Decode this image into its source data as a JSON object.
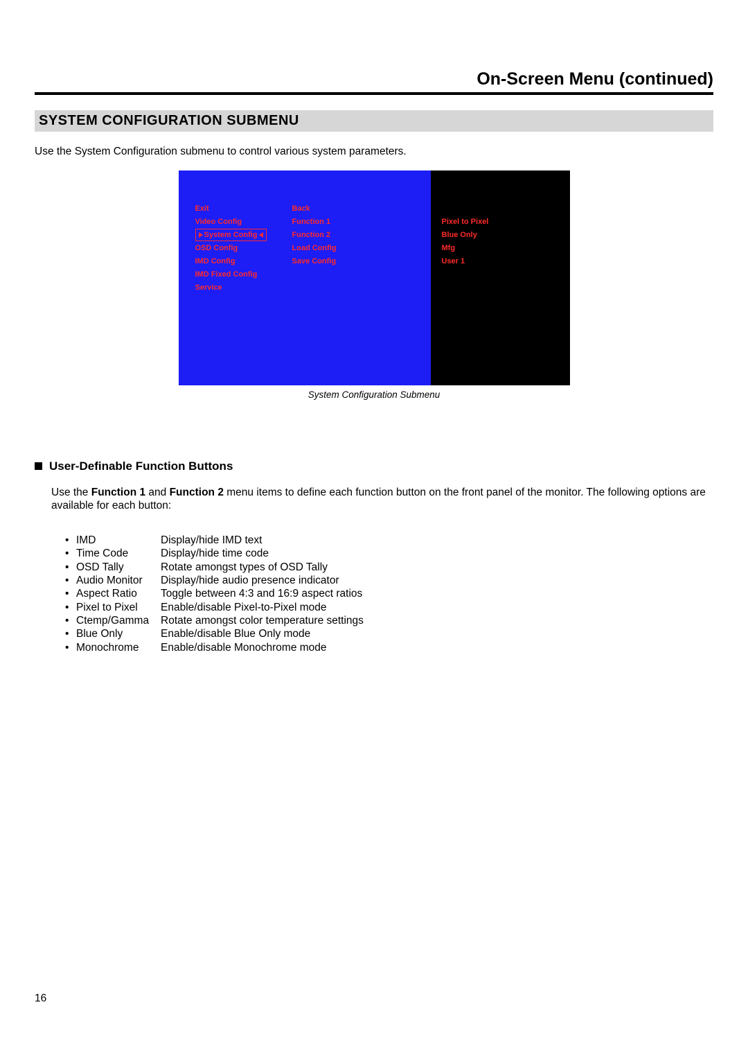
{
  "page_title": "On-Screen Menu (continued)",
  "section_heading": "SYSTEM CONFIGURATION SUBMENU",
  "intro_text": "Use the System Configuration submenu to control various system parameters.",
  "osd": {
    "col1": [
      "Exit",
      "Video Config",
      "System Config",
      "OSD Config",
      "IMD Config",
      "IMD Fixed Config",
      "Service"
    ],
    "selected_index": 2,
    "col2": [
      "Back",
      "Function 1",
      "Function 2",
      "Load Config",
      "Save Config"
    ],
    "col3_offset": 1,
    "col3": [
      "Pixel to Pixel",
      "Blue Only",
      "Mfg",
      "User 1"
    ]
  },
  "figure_caption": "System Configuration Submenu",
  "sub_heading": "User-Definable Function Buttons",
  "sub_para_pre": "Use the ",
  "sub_para_b1": "Function 1",
  "sub_para_mid": " and ",
  "sub_para_b2": "Function 2",
  "sub_para_post": " menu items to define each function button on the front panel of the monitor. The following options are available for each button:",
  "options": [
    {
      "name": "IMD",
      "desc": "Display/hide IMD text"
    },
    {
      "name": "Time Code",
      "desc": "Display/hide time code"
    },
    {
      "name": "OSD Tally",
      "desc": "Rotate amongst types of OSD Tally"
    },
    {
      "name": "Audio Monitor",
      "desc": "Display/hide audio presence indicator"
    },
    {
      "name": "Aspect Ratio",
      "desc": "Toggle between 4:3 and 16:9 aspect ratios"
    },
    {
      "name": "Pixel to Pixel",
      "desc": "Enable/disable Pixel-to-Pixel mode"
    },
    {
      "name": "Ctemp/Gamma",
      "desc": "Rotate amongst color temperature settings"
    },
    {
      "name": "Blue Only",
      "desc": "Enable/disable Blue Only mode"
    },
    {
      "name": "Monochrome",
      "desc": "Enable/disable Monochrome mode"
    }
  ],
  "page_number": "16"
}
